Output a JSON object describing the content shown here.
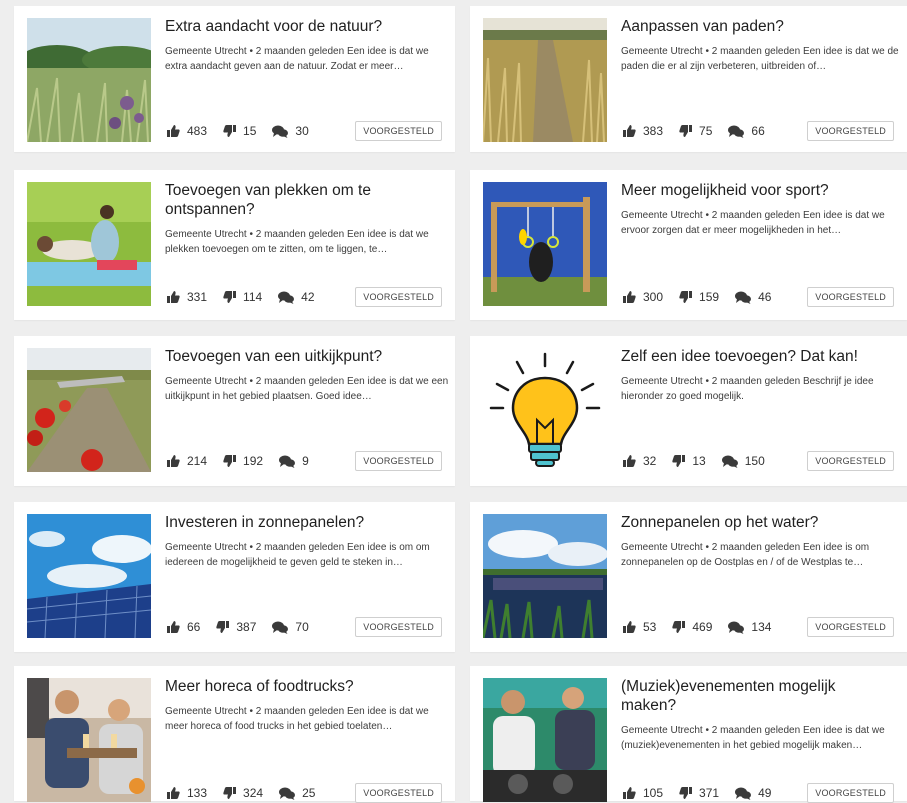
{
  "cards": [
    {
      "title": "Extra aandacht voor de natuur?",
      "description": "Gemeente Utrecht • 2 maanden geleden Een idee is dat we extra aandacht geven aan de natuur. Zodat er meer…",
      "likes": "483",
      "dislikes": "15",
      "comments": "30",
      "status": "VOORGESTELD",
      "image": "meadow-with-thistles"
    },
    {
      "title": "Aanpassen van paden?",
      "description": "Gemeente Utrecht • 2 maanden geleden Een idee is dat we de paden die er al zijn verbeteren, uitbreiden of…",
      "likes": "383",
      "dislikes": "75",
      "comments": "66",
      "status": "VOORGESTELD",
      "image": "path-through-grass"
    },
    {
      "title": "Toevoegen van plekken om te ontspannen?",
      "description": "Gemeente Utrecht • 2 maanden geleden Een idee is dat we plekken toevoegen om te zitten, om te liggen, te…",
      "likes": "331",
      "dislikes": "114",
      "comments": "42",
      "status": "VOORGESTELD",
      "image": "couple-relaxing-on-grass"
    },
    {
      "title": "Meer mogelijkheid voor sport?",
      "description": "Gemeente Utrecht • 2 maanden geleden Een idee is dat we ervoor zorgen dat er meer mogelijkheden in het…",
      "likes": "300",
      "dislikes": "159",
      "comments": "46",
      "status": "VOORGESTELD",
      "image": "outdoor-fitness-rings"
    },
    {
      "title": "Toevoegen van een uitkijkpunt?",
      "description": "Gemeente Utrecht • 2 maanden geleden Een idee is dat we een uitkijkpunt in het gebied plaatsen. Goed idee…",
      "likes": "214",
      "dislikes": "192",
      "comments": "9",
      "status": "VOORGESTELD",
      "image": "poppies-and-lookout"
    },
    {
      "title": "Zelf een idee toevoegen? Dat kan!",
      "description": "Gemeente Utrecht • 2 maanden geleden Beschrijf je idee hieronder zo goed mogelijk.",
      "likes": "32",
      "dislikes": "13",
      "comments": "150",
      "status": "VOORGESTELD",
      "image": "light-bulb"
    },
    {
      "title": "Investeren in zonnepanelen?",
      "description": "Gemeente Utrecht • 2 maanden geleden Een idee is om om iedereen de mogelijkheid te geven geld te steken in…",
      "likes": "66",
      "dislikes": "387",
      "comments": "70",
      "status": "VOORGESTELD",
      "image": "solar-panels-sky"
    },
    {
      "title": "Zonnepanelen op het water?",
      "description": "Gemeente Utrecht • 2 maanden geleden Een idee is om zonnepanelen op de Oostplas en / of de Westplas te…",
      "likes": "53",
      "dislikes": "469",
      "comments": "134",
      "status": "VOORGESTELD",
      "image": "floating-solar-lake"
    },
    {
      "title": "Meer horeca of foodtrucks?",
      "description": "Gemeente Utrecht • 2 maanden geleden Een idee is dat we meer horeca of food trucks in het gebied toelaten…",
      "likes": "133",
      "dislikes": "324",
      "comments": "25",
      "status": "VOORGESTELD",
      "image": "people-drinking-outdoors"
    },
    {
      "title": "(Muziek)evenementen mogelijk maken?",
      "description": "Gemeente Utrecht • 2 maanden geleden Een idee is dat we (muziek)evenementen in het gebied mogelijk maken…",
      "likes": "105",
      "dislikes": "371",
      "comments": "49",
      "status": "VOORGESTELD",
      "image": "dj-at-event"
    }
  ],
  "colors": {
    "card_bg": "#ffffff",
    "page_bg": "#eeeeee",
    "icon": "#3a3a3a",
    "badge_border": "#cfcfcf"
  }
}
